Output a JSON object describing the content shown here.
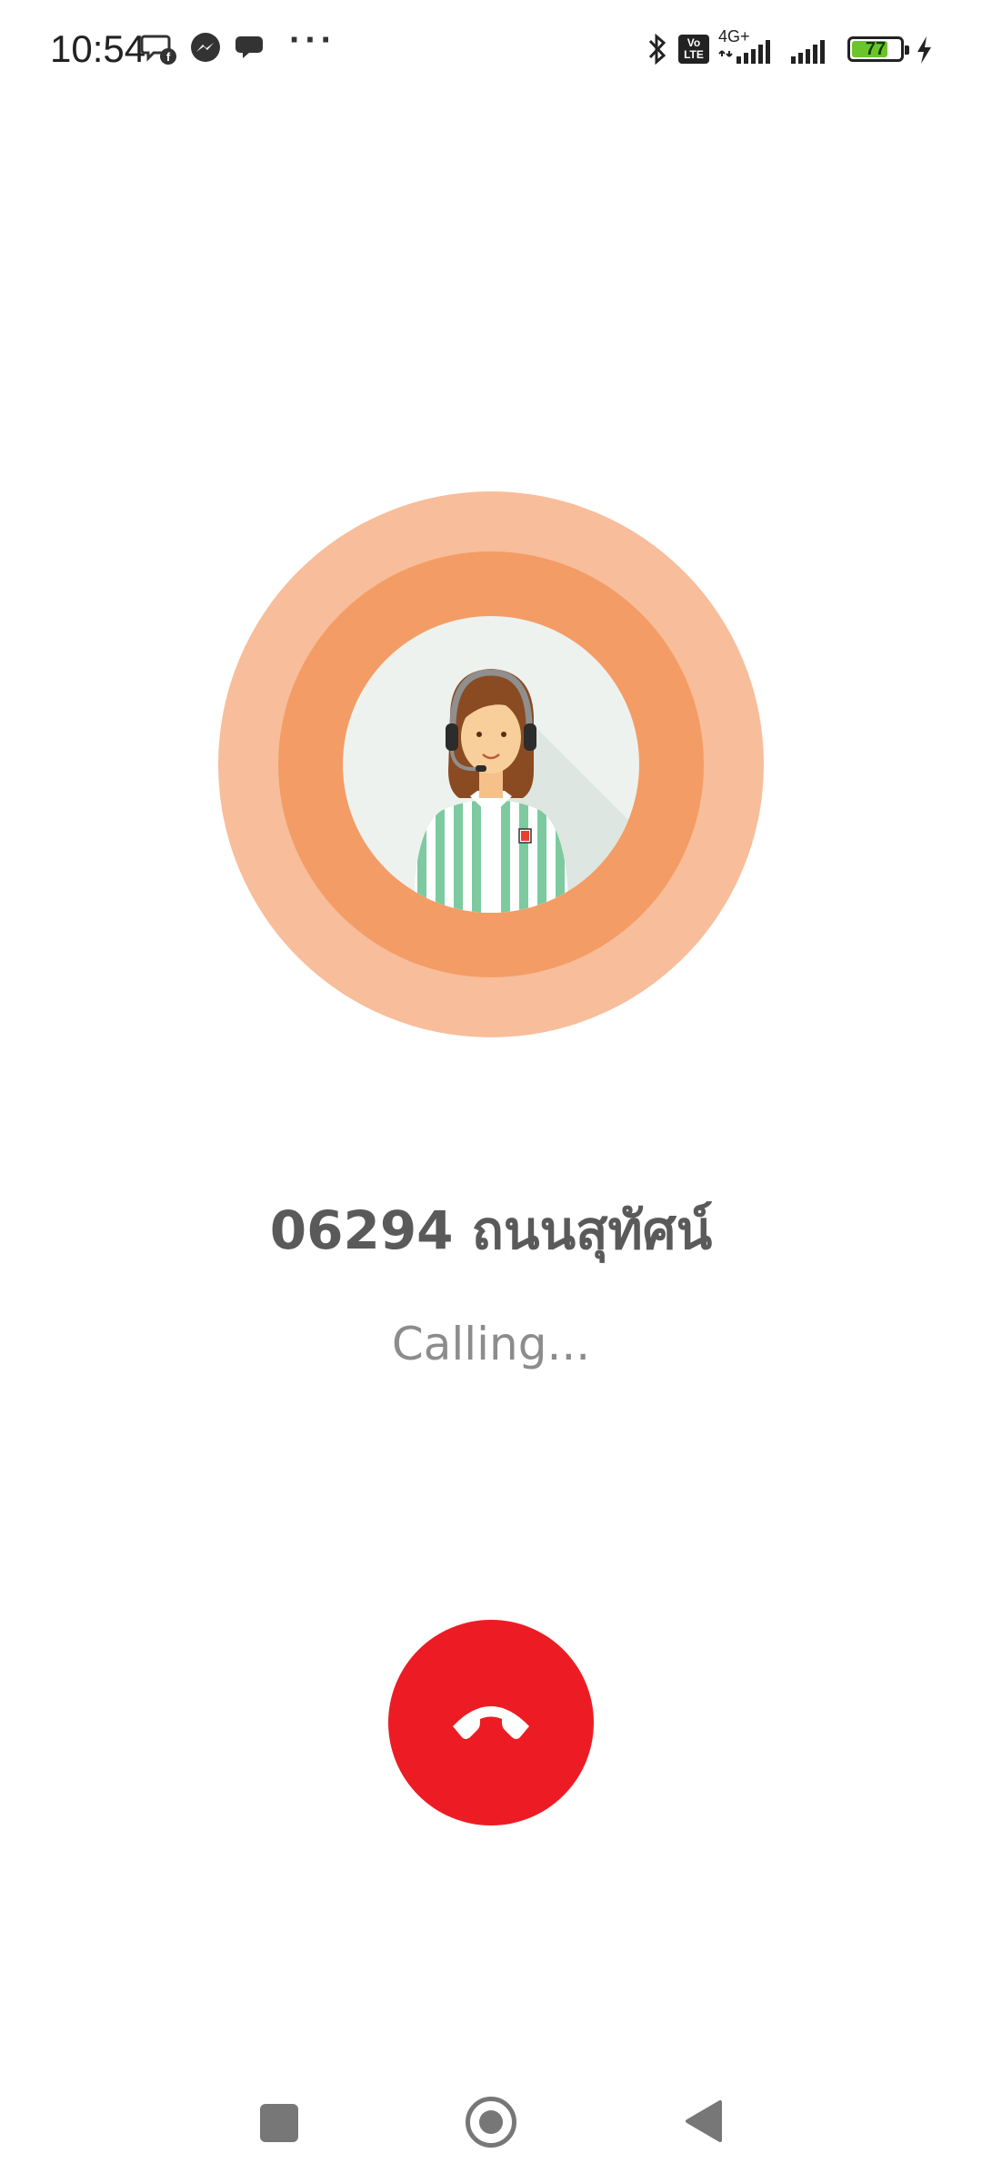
{
  "status_bar": {
    "time": "10:54",
    "notification_icons": [
      "chat-facebook-icon",
      "messenger-icon",
      "speech-bubble-icon"
    ],
    "more": "···",
    "system_icons": [
      "bluetooth-icon",
      "volte-icon",
      "signal-4g-icon",
      "signal-icon"
    ],
    "network_label": "4G+",
    "volte_label": "Vo\nLTE",
    "battery_level": "77",
    "battery_fraction": 0.77,
    "charging": true,
    "battery_color": "#6bc52a"
  },
  "call": {
    "branch_name": "06294 ถนนสุทัศน์",
    "status": "Calling...",
    "avatar_icon": "operator-headset-avatar-icon",
    "ring_outer_color": "#f8bd9a",
    "ring_mid_color": "#f49c65",
    "hangup_color": "#ed1c24",
    "hangup_icon": "end-call-icon"
  },
  "nav_bar": {
    "items": [
      "recents-square-icon",
      "home-circle-icon",
      "back-triangle-icon"
    ]
  }
}
